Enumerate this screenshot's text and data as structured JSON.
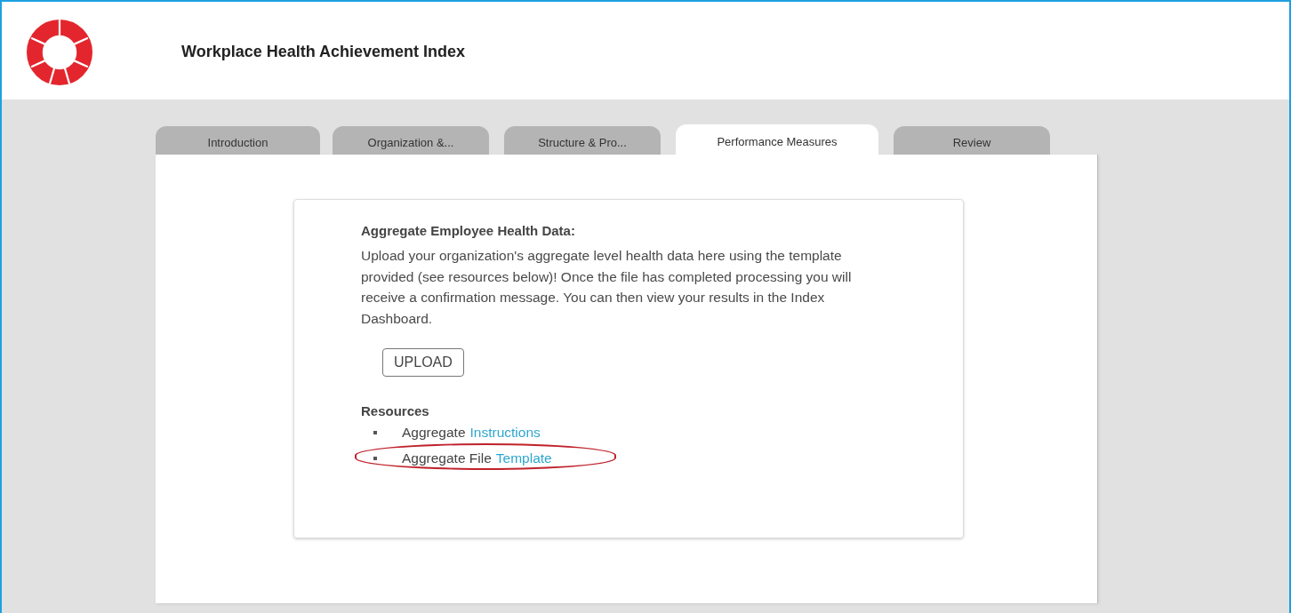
{
  "header": {
    "title": "Workplace Health Achievement Index"
  },
  "tabs": [
    {
      "label": "Introduction",
      "selected": false
    },
    {
      "label": "Organization &...",
      "selected": false
    },
    {
      "label": "Structure & Pro...",
      "selected": false
    },
    {
      "label": "Performance Measures",
      "selected": true
    },
    {
      "label": "Review",
      "selected": false
    }
  ],
  "card": {
    "heading": "Aggregate Employee Health Data:",
    "description": "Upload your organization's aggregate level health data here using the template provided (see resources below)! Once the file has completed processing you will receive a confirmation message. You can then view your results in the Index Dashboard.",
    "upload_button": "UPLOAD",
    "resources_heading": "Resources",
    "resources": [
      {
        "text": "Aggregate",
        "link": "Instructions",
        "highlighted": false
      },
      {
        "text": "Aggregate File",
        "link": "Template",
        "highlighted": true
      }
    ]
  }
}
